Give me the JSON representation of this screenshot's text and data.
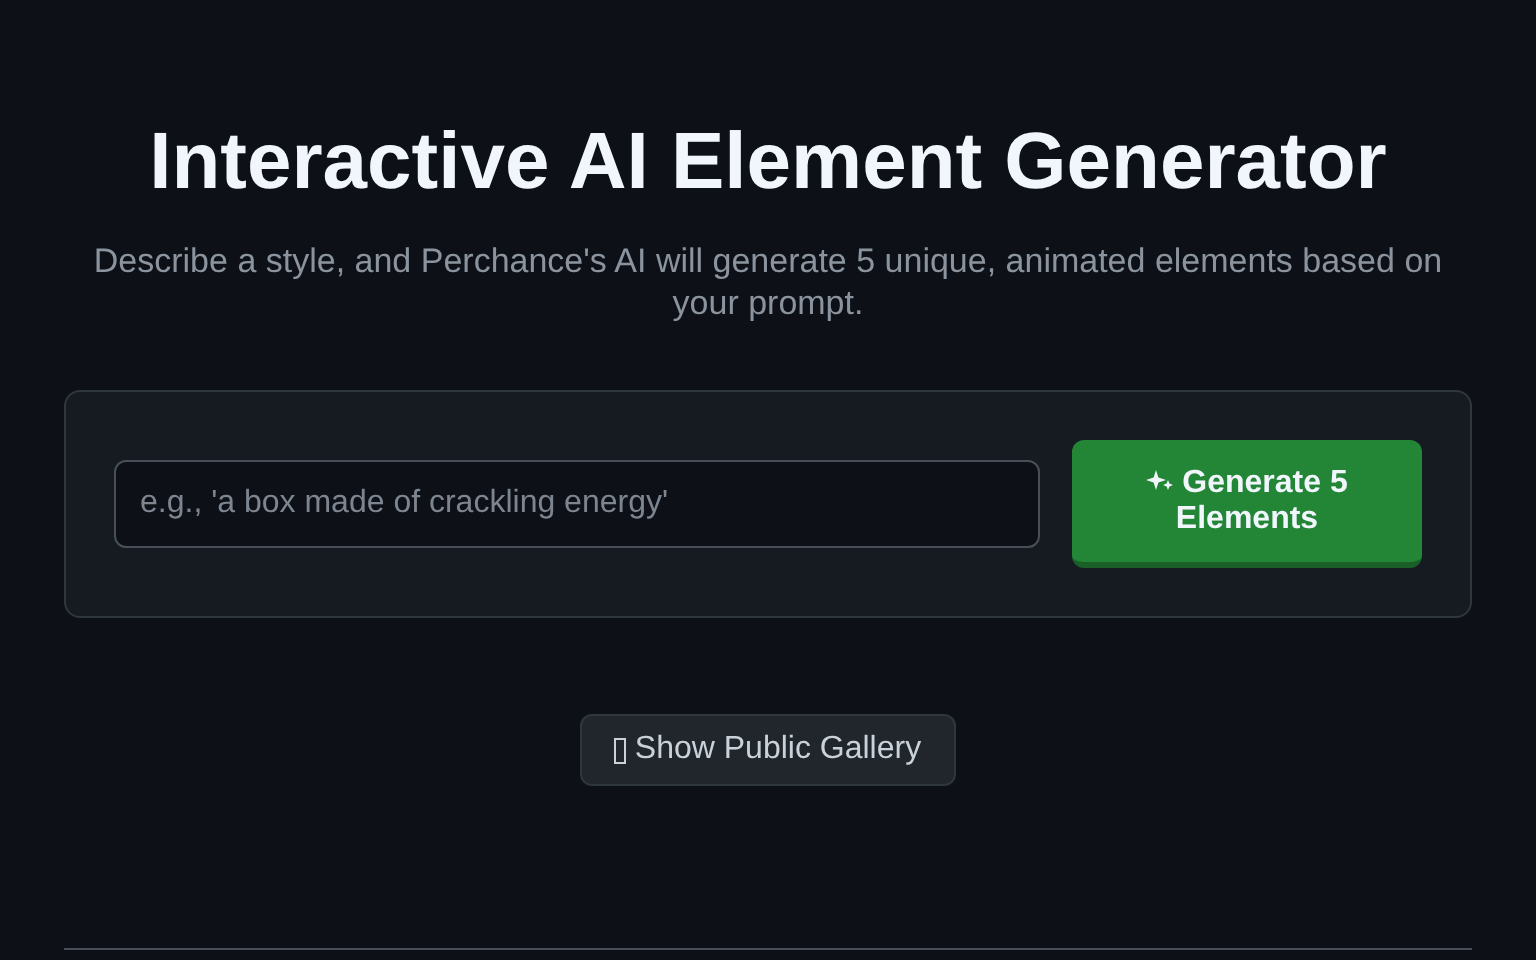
{
  "title": "Interactive AI Element Generator",
  "subtitle": "Describe a style, and Perchance's AI will generate 5 unique, animated elements based on your prompt.",
  "prompt_field": {
    "placeholder": "e.g., 'a box made of crackling energy'"
  },
  "generate_button": {
    "label": "Generate 5 Elements"
  },
  "gallery_button": {
    "label": "Show Public Gallery"
  }
}
